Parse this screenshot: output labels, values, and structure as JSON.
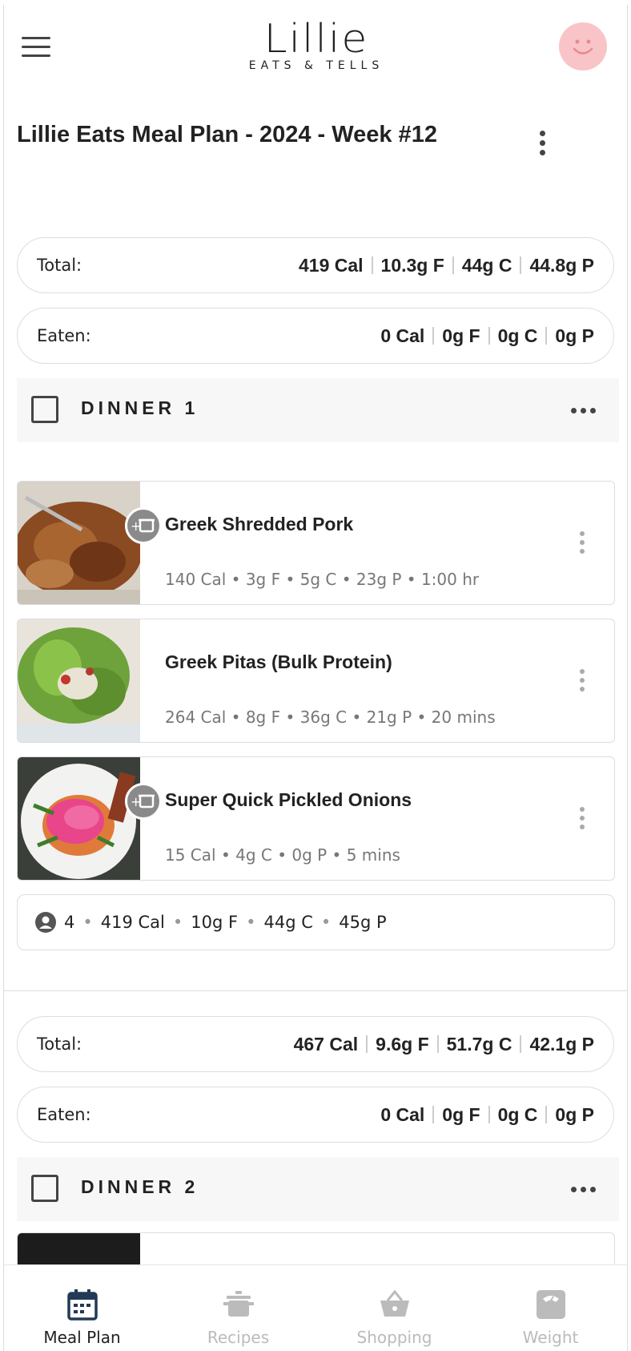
{
  "header": {
    "logo_main": "Lillie",
    "logo_sub": "EATS & TELLS",
    "plan_title": "Lillie Eats Meal Plan - 2024 - Week #12"
  },
  "day1": {
    "total": {
      "label": "Total:",
      "cal": "419 Cal",
      "fat": "10.3g F",
      "carb": "44g C",
      "protein": "44.8g P"
    },
    "eaten": {
      "label": "Eaten:",
      "cal": "0 Cal",
      "fat": "0g F",
      "carb": "0g C",
      "protein": "0g P"
    },
    "meal_title": "DINNER 1",
    "recipes": [
      {
        "name": "Greek Shredded Pork",
        "meta": "140 Cal • 3g F • 5g C • 23g P • 1:00 hr"
      },
      {
        "name": "Greek Pitas (Bulk Protein)",
        "meta": "264 Cal • 8g F • 36g C • 21g P • 20 mins"
      },
      {
        "name": "Super Quick Pickled Onions",
        "meta": "15 Cal • 4g C • 0g P • 5 mins"
      }
    ],
    "summary": {
      "servings": "4",
      "cal": "419 Cal",
      "fat": "10g F",
      "carb": "44g C",
      "protein": "45g P"
    }
  },
  "day2": {
    "total": {
      "label": "Total:",
      "cal": "467 Cal",
      "fat": "9.6g F",
      "carb": "51.7g C",
      "protein": "42.1g P"
    },
    "eaten": {
      "label": "Eaten:",
      "cal": "0 Cal",
      "fat": "0g F",
      "carb": "0g C",
      "protein": "0g P"
    },
    "meal_title": "DINNER 2"
  },
  "tabs": [
    {
      "label": "Meal Plan",
      "icon": "calendar-icon",
      "active": true
    },
    {
      "label": "Recipes",
      "icon": "pot-icon"
    },
    {
      "label": "Shopping",
      "icon": "basket-icon"
    },
    {
      "label": "Weight",
      "icon": "scale-icon"
    }
  ],
  "colors": {
    "avatar": "#f9c4c7",
    "text": "#222222",
    "muted": "#777777",
    "tab_inactive": "#bbbbbb"
  }
}
